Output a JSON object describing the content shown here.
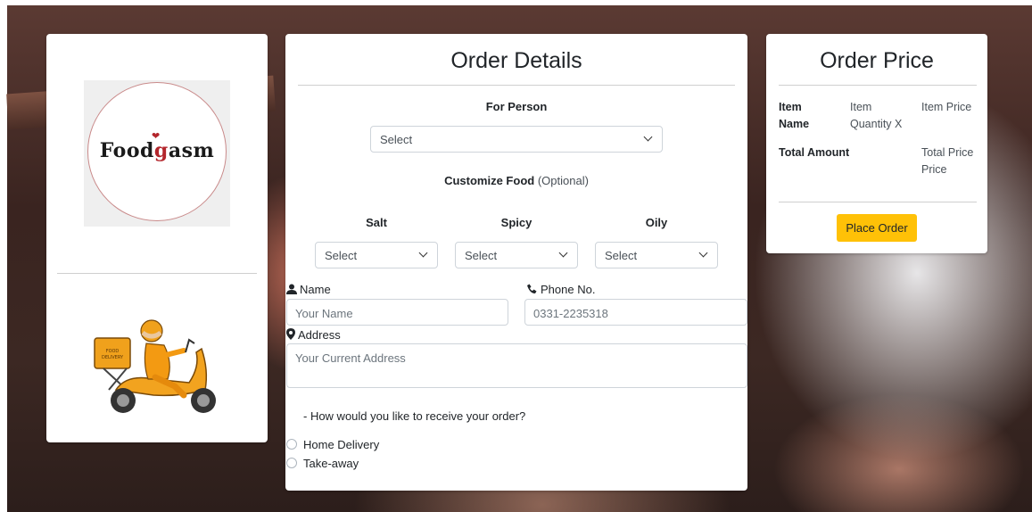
{
  "brand": {
    "logo_text_left": "Food",
    "logo_text_mid": "g",
    "logo_text_right": "asm",
    "accent": "#b3262c"
  },
  "order_details": {
    "title": "Order Details",
    "for_person_label": "For Person",
    "for_person_value": "Select",
    "customize_label": "Customize Food",
    "customize_optional": "(Optional)",
    "salt_label": "Salt",
    "spicy_label": "Spicy",
    "oily_label": "Oily",
    "salt_value": "Select",
    "spicy_value": "Select",
    "oily_value": "Select",
    "name_label": "Name",
    "name_placeholder": "Your Name",
    "phone_label": "Phone No.",
    "phone_placeholder": "0331-2235318",
    "address_label": "Address",
    "address_placeholder": "Your Current Address",
    "receive_question": "- How would you like to receive your order?",
    "option_home": "Home Delivery",
    "option_takeaway": "Take-away"
  },
  "order_price": {
    "title": "Order Price",
    "col_item_name": "Item Name",
    "col_item_quantity": "Item Quantity X",
    "col_item_price": "Item Price",
    "total_label": "Total Amount",
    "total_value": "Total Price Price",
    "place_order": "Place Order",
    "button_color": "#ffc107"
  },
  "scooter": {
    "box_label_1": "FOOD",
    "box_label_2": "DELIVERY"
  }
}
